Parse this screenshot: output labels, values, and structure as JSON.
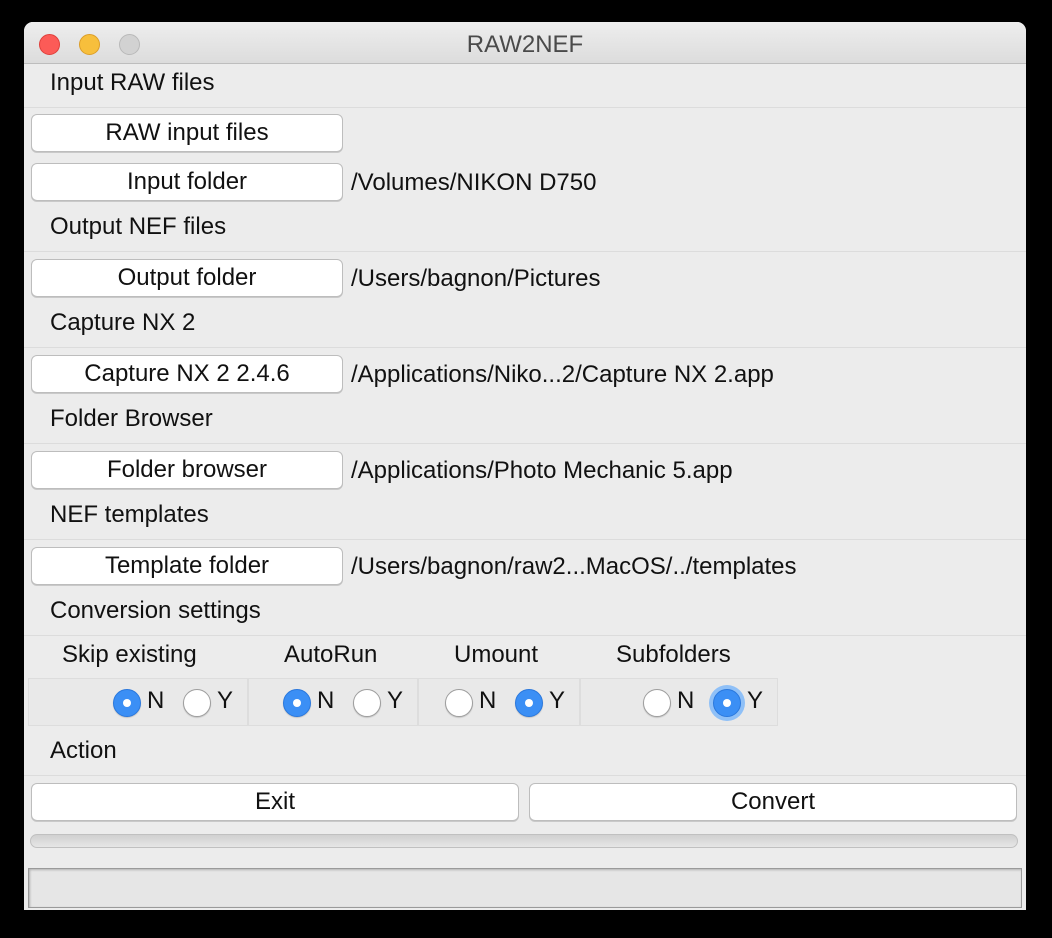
{
  "window": {
    "title": "RAW2NEF"
  },
  "sections": {
    "input": "Input RAW files",
    "output": "Output NEF files",
    "capture": "Capture NX 2",
    "browser": "Folder Browser",
    "templates": "NEF templates",
    "settings": "Conversion settings",
    "action": "Action"
  },
  "buttons": {
    "raw_input": "RAW input files",
    "input_folder": "Input folder",
    "output_folder": "Output folder",
    "capture_nx": "Capture NX 2 2.4.6",
    "folder_browser": "Folder browser",
    "template_folder": "Template folder",
    "exit": "Exit",
    "convert": "Convert"
  },
  "paths": {
    "input_folder": "/Volumes/NIKON D750",
    "output_folder": "/Users/bagnon/Pictures",
    "capture_nx": "/Applications/Niko...2/Capture NX 2.app",
    "folder_browser": "/Applications/Photo Mechanic 5.app",
    "template_folder": "/Users/bagnon/raw2...MacOS/../templates"
  },
  "options": [
    {
      "label": "Skip existing",
      "selected": "N",
      "n": "N",
      "y": "Y"
    },
    {
      "label": "AutoRun",
      "selected": "N",
      "n": "N",
      "y": "Y"
    },
    {
      "label": "Umount",
      "selected": "Y",
      "n": "N",
      "y": "Y"
    },
    {
      "label": "Subfolders",
      "selected": "Y",
      "n": "N",
      "y": "Y",
      "focused": true
    }
  ],
  "progress": {
    "value": 0
  },
  "colors": {
    "radio_on": "#3b8ff5",
    "close": "#fc5b57",
    "minimize": "#f7bf3c",
    "zoom": "#d2d2d2"
  }
}
